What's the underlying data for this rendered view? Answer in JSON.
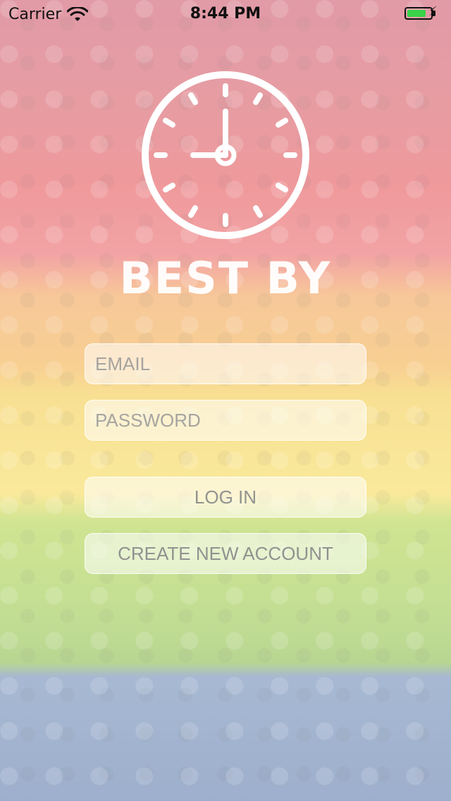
{
  "status_bar": {
    "carrier": "Carrier",
    "time": "8:44 PM",
    "battery_level": 0.8,
    "battery_color": "#39d34a"
  },
  "app": {
    "title": "BEST BY",
    "logo_icon": "clock-icon"
  },
  "form": {
    "email_placeholder": "EMAIL",
    "email_value": "",
    "password_placeholder": "PASSWORD",
    "password_value": "",
    "login_label": "LOG IN",
    "create_account_label": "CREATE NEW ACCOUNT"
  },
  "background": {
    "description_icon": "fruit-background-image"
  }
}
